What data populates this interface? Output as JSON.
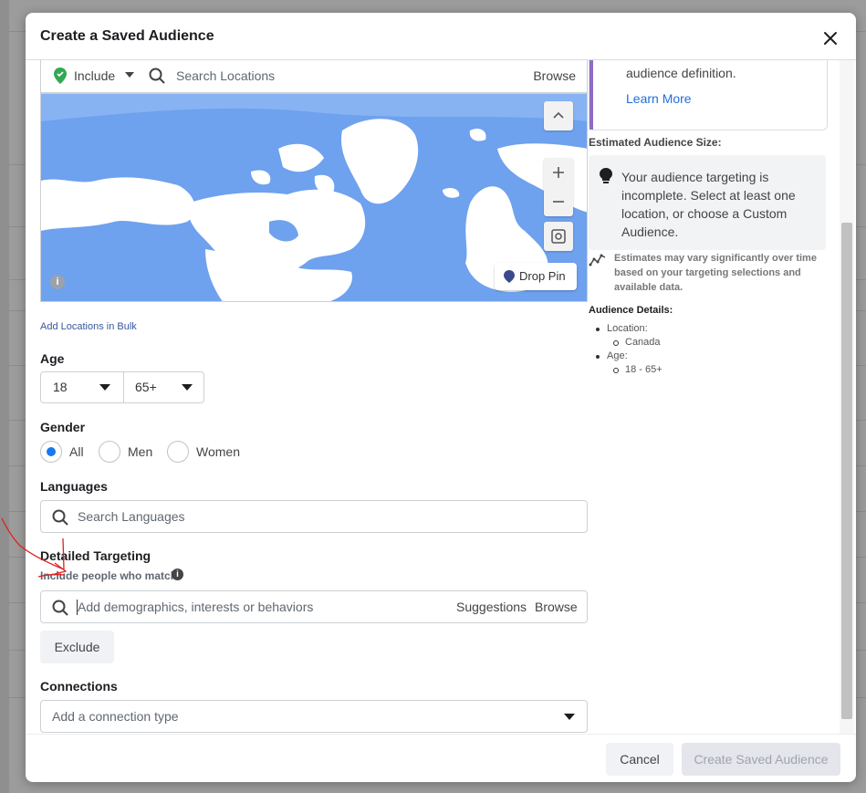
{
  "modal": {
    "title": "Create a Saved Audience",
    "close_icon": "close-icon"
  },
  "location": {
    "include_label": "Include",
    "search_placeholder": "Search Locations",
    "browse_label": "Browse",
    "drop_pin_label": "Drop Pin",
    "bulk_link": "Add Locations in Bulk"
  },
  "age": {
    "label": "Age",
    "min": "18",
    "max": "65+"
  },
  "gender": {
    "label": "Gender",
    "options": [
      "All",
      "Men",
      "Women"
    ],
    "selected": "All"
  },
  "languages": {
    "label": "Languages",
    "placeholder": "Search Languages"
  },
  "detailed_targeting": {
    "label": "Detailed Targeting",
    "sublabel": "Include people who match",
    "placeholder": "Add demographics, interests or behaviors",
    "suggestions_label": "Suggestions",
    "browse_label": "Browse",
    "exclude_label": "Exclude"
  },
  "connections": {
    "label": "Connections",
    "placeholder": "Add a connection type"
  },
  "sidebar": {
    "definition_text": "audience definition.",
    "learn_more": "Learn More",
    "estimated_title": "Estimated Audience Size:",
    "estimated_message": "Your audience targeting is incomplete. Select at least one location, or choose a Custom Audience.",
    "estimate_note": "Estimates may vary significantly over time based on your targeting selections and available data.",
    "details_title": "Audience Details:",
    "details": [
      {
        "key": "Location:",
        "value": "Canada"
      },
      {
        "key": "Age:",
        "value": "18 - 65+"
      }
    ]
  },
  "footer": {
    "cancel": "Cancel",
    "create": "Create Saved Audience"
  },
  "colors": {
    "accent": "#1877f2",
    "map_water": "#6ea1ee",
    "map_land": "#ffffff",
    "annotation": "#e02020"
  }
}
